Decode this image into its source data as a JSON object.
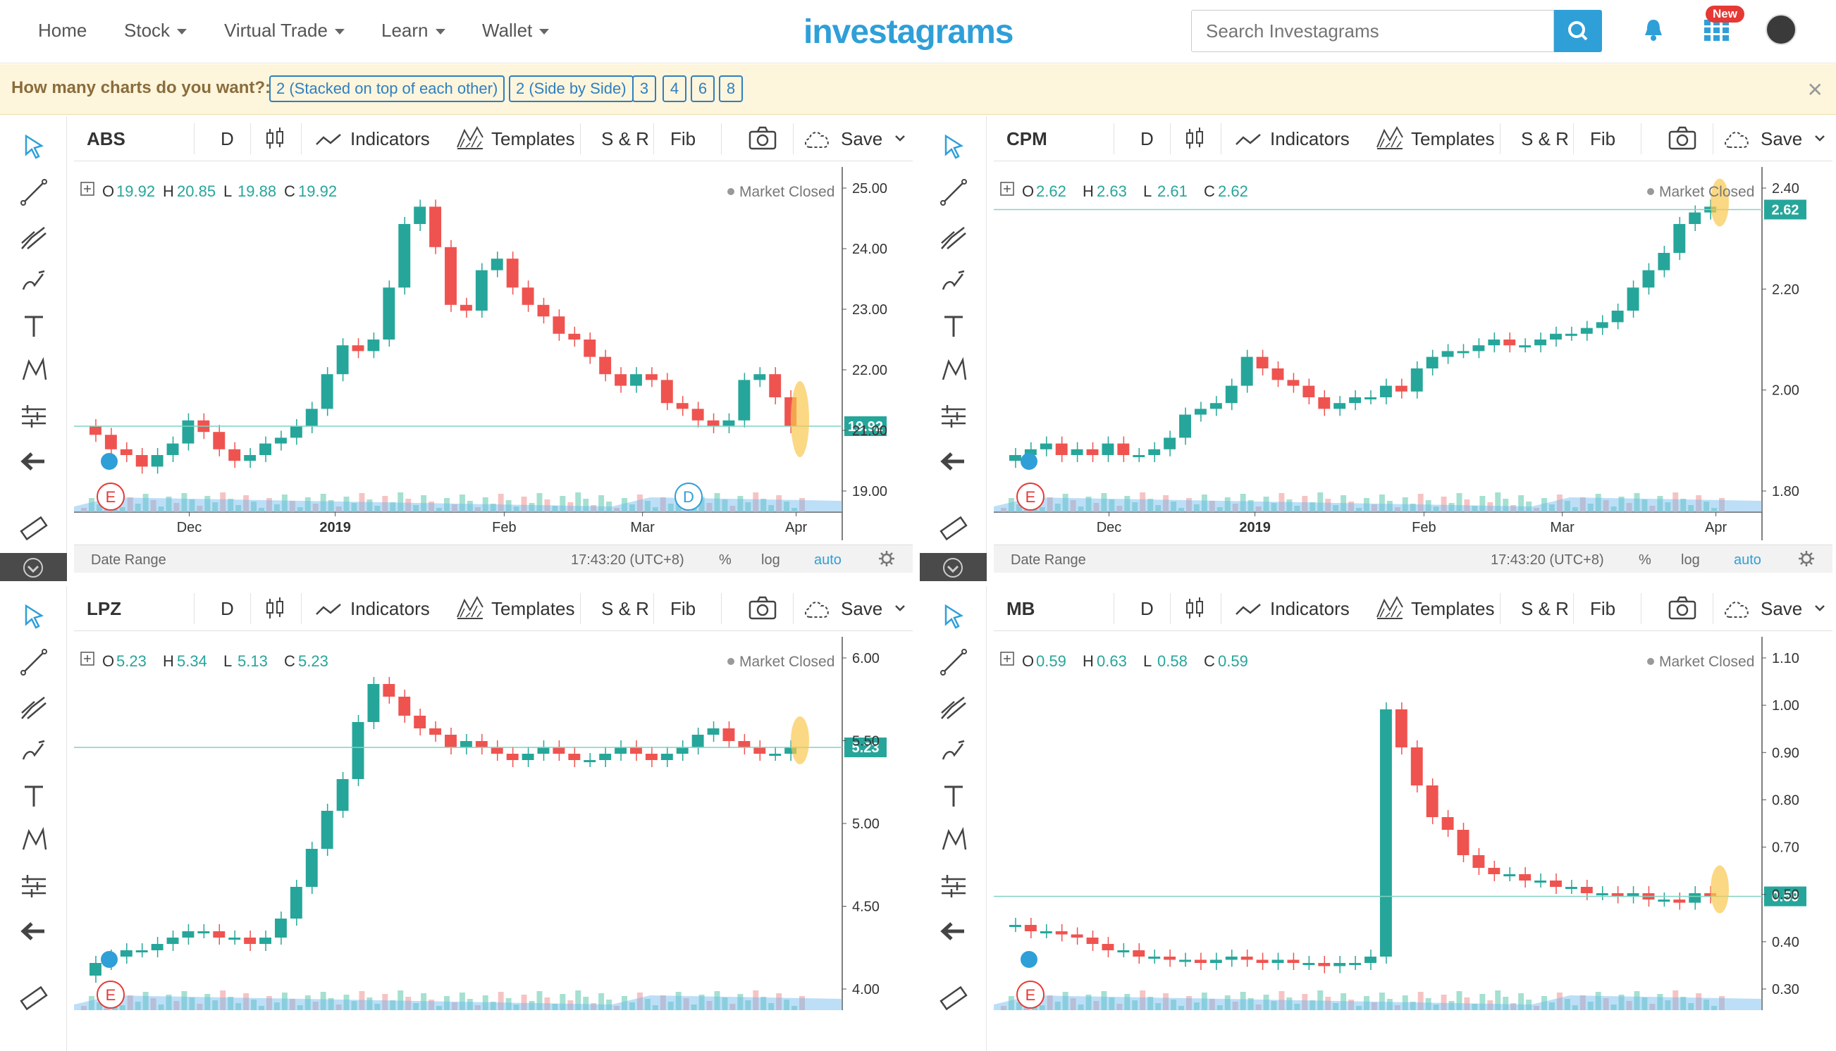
{
  "nav": {
    "items": [
      {
        "label": "Home",
        "caret": false
      },
      {
        "label": "Stock",
        "caret": true
      },
      {
        "label": "Virtual Trade",
        "caret": true
      },
      {
        "label": "Learn",
        "caret": true
      },
      {
        "label": "Wallet",
        "caret": true
      }
    ],
    "logo": "investagrams",
    "search_placeholder": "Search Investagrams",
    "new_badge": "New"
  },
  "chooser": {
    "question": "How many charts do you want?:",
    "options": [
      "2 (Stacked on top of each other)",
      "2 (Side by Side)",
      "3",
      "4",
      "6",
      "8"
    ]
  },
  "toolbar": {
    "interval": "D",
    "indicators": "Indicators",
    "templates": "Templates",
    "sr": "S & R",
    "fib": "Fib",
    "save": "Save"
  },
  "datebar": {
    "date_range": "Date Range",
    "time": "17:43:20 (UTC+8)",
    "percent": "%",
    "log": "log",
    "auto": "auto"
  },
  "market_closed": "Market Closed",
  "ohlc_labels": {
    "o": "O",
    "h": "H",
    "l": "L",
    "c": "C"
  },
  "panels": [
    {
      "symbol": "ABS",
      "o": "19.92",
      "h": "20.85",
      "l": "19.88",
      "c": "19.92",
      "price_tag": "19.92",
      "y_ticks": [
        "25.00",
        "24.00",
        "23.00",
        "22.00",
        "21.00",
        "19.00"
      ],
      "x_ticks": [
        "Dec",
        "2019",
        "Feb",
        "Mar",
        "Apr"
      ],
      "markers": [
        "E",
        "D"
      ]
    },
    {
      "symbol": "CPM",
      "o": "2.62",
      "h": "2.63",
      "l": "2.61",
      "c": "2.62",
      "price_tag": "2.62",
      "y_ticks": [
        "2.40",
        "2.20",
        "2.00",
        "1.80"
      ],
      "x_ticks": [
        "Dec",
        "2019",
        "Feb",
        "Mar",
        "Apr"
      ],
      "markers": [
        "E"
      ]
    },
    {
      "symbol": "LPZ",
      "o": "5.23",
      "h": "5.34",
      "l": "5.13",
      "c": "5.23",
      "price_tag": "5.23",
      "y_ticks": [
        "6.00",
        "5.50",
        "5.00",
        "4.50",
        "4.00"
      ],
      "x_ticks": [],
      "markers": [
        "E"
      ]
    },
    {
      "symbol": "MB",
      "o": "0.59",
      "h": "0.63",
      "l": "0.58",
      "c": "0.59",
      "price_tag": "0.59",
      "y_ticks": [
        "1.10",
        "1.00",
        "0.90",
        "0.80",
        "0.70",
        "0.50",
        "0.40",
        "0.30"
      ],
      "x_ticks": [],
      "markers": [
        "E"
      ]
    }
  ]
}
